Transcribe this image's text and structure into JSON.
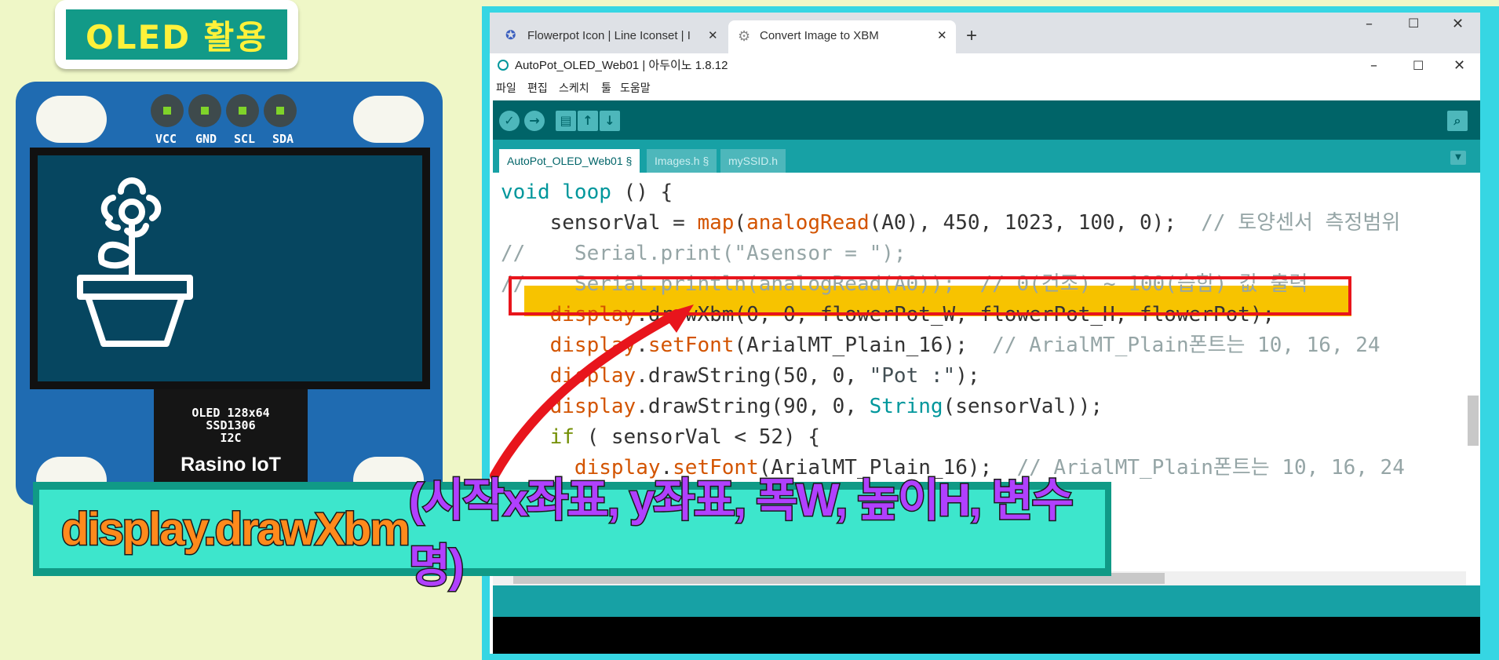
{
  "overlay": {
    "label": "OLED 활용",
    "banner": {
      "func": "display.drawXbm",
      "args": " (시작x좌표, y좌표, 폭W, 높이H, 변수명)"
    }
  },
  "board": {
    "pins": [
      "VCC",
      "GND",
      "SCL",
      "SDA"
    ],
    "chip_lines": [
      "OLED 128x64",
      "SSD1306",
      "I2C"
    ],
    "brand": "Rasino IoT",
    "screen_icon": "flowerpot-icon"
  },
  "browser": {
    "tabs": [
      {
        "title": "Flowerpot Icon | Line Iconset | I",
        "icon": "star-icon"
      },
      {
        "title": "Convert Image to XBM",
        "icon": "gear-icon"
      }
    ],
    "new_tab": "+"
  },
  "arduino": {
    "window_title": "AutoPot_OLED_Web01 | 아두이노 1.8.12",
    "menu": [
      "파일",
      "편집",
      "스케치",
      "툴",
      "도움말"
    ],
    "tabs": [
      "AutoPot_OLED_Web01 §",
      "Images.h §",
      "mySSID.h"
    ],
    "code": [
      [
        {
          "t": "void",
          "c": "kw-t"
        },
        {
          "t": " "
        },
        {
          "t": "loop",
          "c": "kw-t"
        },
        {
          "t": " () {"
        }
      ],
      [
        {
          "t": "    sensorVal = "
        },
        {
          "t": "map",
          "c": "kw-f"
        },
        {
          "t": "("
        },
        {
          "t": "analogRead",
          "c": "kw-f"
        },
        {
          "t": "(A0), 450, 1023, 100, 0);  "
        },
        {
          "t": "// 토양센서 측정범위",
          "c": "cm"
        }
      ],
      [
        {
          "t": "//    Serial.print(\"Asensor = \");",
          "c": "cm"
        }
      ],
      [
        {
          "t": "//    Serial.println(analogRead(A0));  // 0(건조) ~ 100(습함) 값 출력",
          "c": "cm"
        }
      ],
      [
        {
          "t": "    "
        },
        {
          "t": "display",
          "c": "kw-f"
        },
        {
          "t": ".drawXbm(0, 0, flowerPot_W, flowerPot_H, flowerPot);"
        }
      ],
      [
        {
          "t": "    "
        },
        {
          "t": "display",
          "c": "kw-f"
        },
        {
          "t": "."
        },
        {
          "t": "setFont",
          "c": "kw-f"
        },
        {
          "t": "(ArialMT_Plain_16);  "
        },
        {
          "t": "// ArialMT_Plain폰트는 10, 16, 24",
          "c": "cm"
        }
      ],
      [
        {
          "t": "    "
        },
        {
          "t": "display",
          "c": "kw-f"
        },
        {
          "t": ".drawString(50, 0, "
        },
        {
          "t": "\"Pot :\"",
          "c": "kw-c"
        },
        {
          "t": ");"
        }
      ],
      [
        {
          "t": "    "
        },
        {
          "t": "display",
          "c": "kw-f"
        },
        {
          "t": ".drawString(90, 0, "
        },
        {
          "t": "String",
          "c": "kw-t"
        },
        {
          "t": "(sensorVal));"
        }
      ],
      [
        {
          "t": "    "
        },
        {
          "t": "if",
          "c": "kw-k"
        },
        {
          "t": " ( sensorVal < 52) {"
        }
      ],
      [
        {
          "t": "      "
        },
        {
          "t": "display",
          "c": "kw-f"
        },
        {
          "t": "."
        },
        {
          "t": "setFont",
          "c": "kw-f"
        },
        {
          "t": "(ArialMT_Plain_16);  "
        },
        {
          "t": "// ArialMT_Plain폰트는 10, 16, 24",
          "c": "cm"
        }
      ]
    ]
  },
  "colors": {
    "ide_teal": "#006468",
    "tab_teal": "#17a1a5",
    "highlight": "#f7c300",
    "annotation_red": "#e8151c",
    "banner_orange": "#ff8a1c",
    "banner_purple": "#9b3cf0",
    "banner_magenta": "#ff35c8"
  }
}
